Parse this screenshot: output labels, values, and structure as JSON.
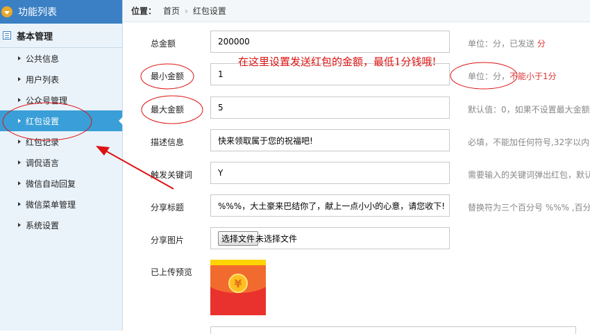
{
  "sidebar": {
    "header": "功能列表",
    "section": "基本管理",
    "items": [
      {
        "label": "公共信息"
      },
      {
        "label": "用户列表"
      },
      {
        "label": "公众号管理"
      },
      {
        "label": "红包设置"
      },
      {
        "label": "红包记录"
      },
      {
        "label": "调侃语言"
      },
      {
        "label": "微信自动回复"
      },
      {
        "label": "微信菜单管理"
      },
      {
        "label": "系统设置"
      }
    ]
  },
  "breadcrumb": {
    "label": "位置：",
    "home": "首页",
    "current": "红包设置"
  },
  "form": {
    "total": {
      "label": "总金额",
      "value": "200000",
      "hint": "单位：分，已发送",
      "hint_red": "分"
    },
    "min": {
      "label": "最小金额",
      "value": "1",
      "hint": "单位：分，",
      "hint_red": "不能小于1分"
    },
    "max": {
      "label": "最大金额",
      "value": "5",
      "hint": "默认值：0，如果不设置最大金额"
    },
    "desc": {
      "label": "描述信息",
      "value": "快来领取属于您的祝福吧!",
      "hint": "必填，不能加任何符号,32字以内"
    },
    "keyword": {
      "label": "触发关键词",
      "value": "Y",
      "hint": "需要输入的关键词弹出红包，默认"
    },
    "share_title": {
      "label": "分享标题",
      "value": "%%%，大土豪来巴结你了，献上一点小小的心意，请您收下!",
      "hint": "替换符为三个百分号 %%% ,百分"
    },
    "share_image": {
      "label": "分享图片",
      "button": "选择文件",
      "status": "未选择文件"
    },
    "preview": {
      "label": "已上传预览"
    }
  },
  "annotation": "在这里设置发送红包的金额，最低1分钱哦!",
  "colors": {
    "sidebar_header": "#3b80c4",
    "active_item": "#3a9fd8",
    "annotation_red": "#d11"
  }
}
